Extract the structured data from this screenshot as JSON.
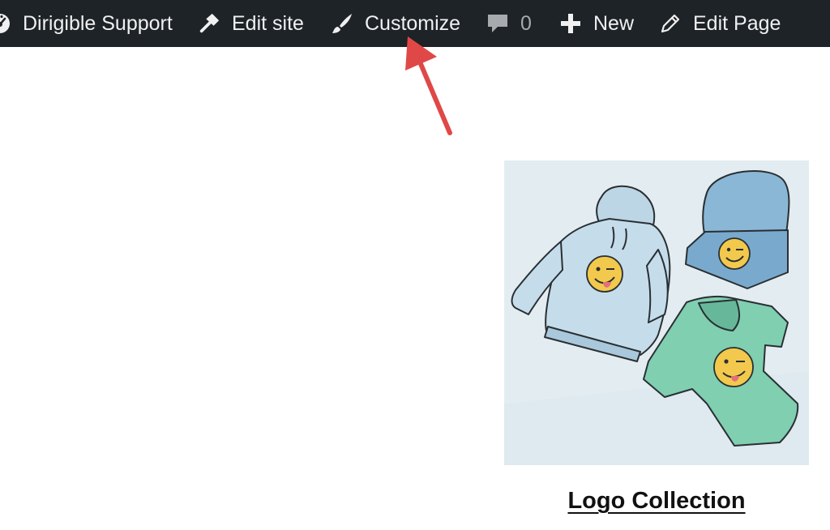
{
  "admin_bar": {
    "site_name": "Dirigible Support",
    "edit_site": "Edit site",
    "customize": "Customize",
    "comments_count": "0",
    "new": "New",
    "edit_page": "Edit Page"
  },
  "product": {
    "title": "Logo Collection"
  },
  "colors": {
    "admin_bar_bg": "#1e2327",
    "admin_bar_text": "#f0f0f1",
    "annotation_arrow": "#e04848"
  }
}
